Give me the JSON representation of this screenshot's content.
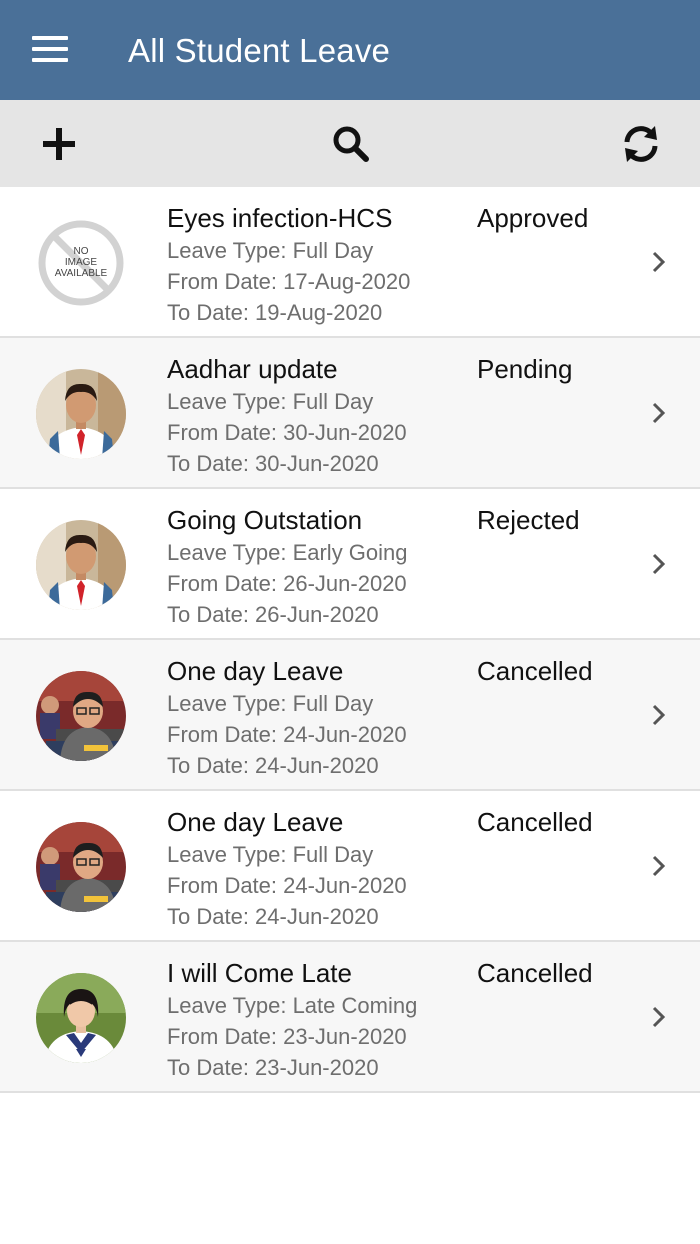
{
  "header": {
    "title": "All Student Leave",
    "background": "#4a7098"
  },
  "toolbar": {
    "add_icon": "plus-icon",
    "search_icon": "search-icon",
    "refresh_icon": "refresh-icon"
  },
  "leaves": [
    {
      "title": "Eyes infection-HCS",
      "status": "Approved",
      "leave_type": "Leave Type: Full Day",
      "from_date": "From Date: 17-Aug-2020",
      "to_date": "To Date: 19-Aug-2020",
      "avatar_text": [
        "NO",
        "IMAGE",
        "AVAILABLE"
      ]
    },
    {
      "title": "Aadhar update",
      "status": "Pending",
      "leave_type": "Leave Type: Full Day",
      "from_date": "From Date: 30-Jun-2020",
      "to_date": "To Date: 30-Jun-2020"
    },
    {
      "title": "Going Outstation",
      "status": "Rejected",
      "leave_type": "Leave Type: Early Going",
      "from_date": "From Date: 26-Jun-2020",
      "to_date": "To Date: 26-Jun-2020"
    },
    {
      "title": "One day Leave",
      "status": "Cancelled",
      "leave_type": "Leave Type: Full Day",
      "from_date": "From Date: 24-Jun-2020",
      "to_date": "To Date: 24-Jun-2020"
    },
    {
      "title": "One day Leave",
      "status": "Cancelled",
      "leave_type": "Leave Type: Full Day",
      "from_date": "From Date: 24-Jun-2020",
      "to_date": "To Date: 24-Jun-2020"
    },
    {
      "title": "I will Come Late",
      "status": "Cancelled",
      "leave_type": "Leave Type: Late Coming",
      "from_date": "From Date: 23-Jun-2020",
      "to_date": "To Date: 23-Jun-2020"
    }
  ]
}
